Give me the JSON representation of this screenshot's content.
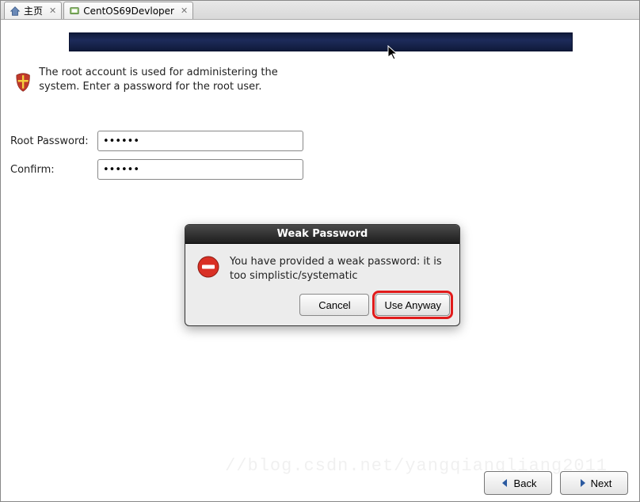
{
  "tabs": [
    {
      "label": "主页",
      "icon": "home"
    },
    {
      "label": "CentOS69Devloper",
      "icon": "vm"
    }
  ],
  "intro": "The root account is used for administering the system.  Enter a password for the root user.",
  "form": {
    "root_label": "Root Password:",
    "confirm_label": "Confirm:",
    "root_value": "••••••",
    "confirm_value": "••••••"
  },
  "dialog": {
    "title": "Weak Password",
    "message": "You have provided a weak password: it is too simplistic/systematic",
    "cancel": "Cancel",
    "use_anyway": "Use Anyway"
  },
  "nav": {
    "back": "Back",
    "next": "Next"
  },
  "watermark": "//blog.csdn.net/yangqiangliang2011"
}
